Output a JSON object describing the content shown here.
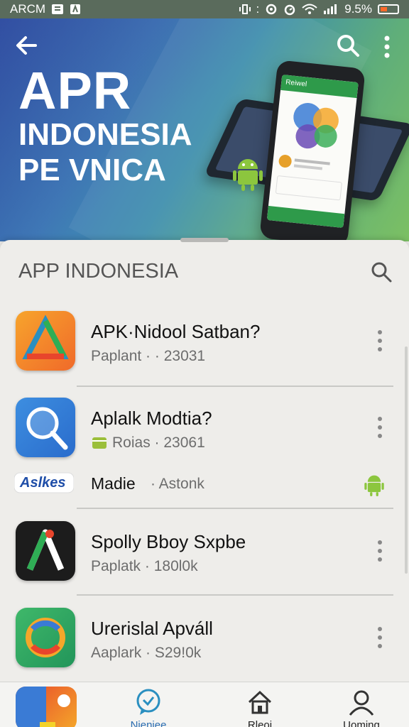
{
  "status_bar": {
    "carrier": "ARCM",
    "battery": "9.5%"
  },
  "hero": {
    "title_line1": "APR",
    "title_line2": "INDONESIA",
    "title_line3": "PE VNICA",
    "phone_screen_title": "Reiwel"
  },
  "list": {
    "section_title": "APP INDONESIA",
    "apps": [
      {
        "name": "APK·Nidool Satban?",
        "meta": "Paplant · · 23031",
        "icon": "colorful-triangle-app-icon"
      },
      {
        "name": "Aplalk Modtia?",
        "meta": "Roias · 23061",
        "icon": "magnifier-app-icon"
      },
      {
        "name": "Spolly Bboy Sxpbe",
        "meta": "Paplatk · 180l0k",
        "icon": "letter-a-app-icon"
      },
      {
        "name": "Urerislal Apváll",
        "meta": "Aaplark · S29!0k",
        "icon": "swirl-app-icon"
      }
    ],
    "sub_item": {
      "logo_text": "Aslkes",
      "title": "Madie",
      "meta": "· Astonk"
    }
  },
  "bottom_nav": {
    "items": [
      {
        "label": "Nieniee",
        "icon": "chat-check-icon",
        "active": true
      },
      {
        "label": "Rleoi",
        "icon": "home-icon",
        "active": false
      },
      {
        "label": "Uoming",
        "icon": "profile-icon",
        "active": false
      }
    ]
  },
  "colors": {
    "accent": "#2a8fc0",
    "android_green": "#8cc63e",
    "status_bar": "#5a6b5c"
  }
}
